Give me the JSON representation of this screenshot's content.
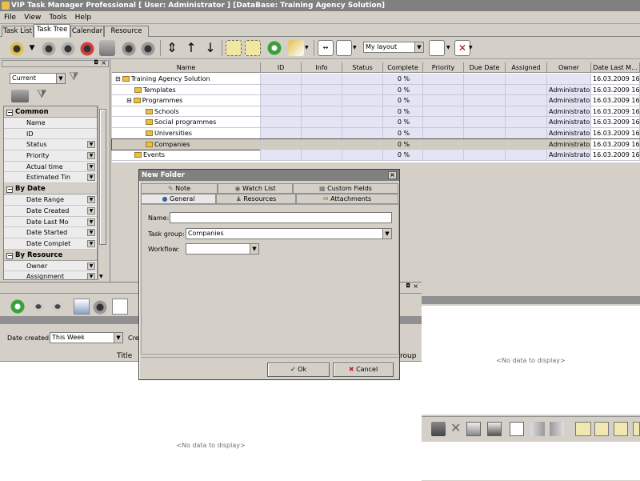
{
  "window": {
    "title": "VIP Task Manager Professional [ User: Administrator ] [DataBase: Training Agency Solution]"
  },
  "menu": [
    "File",
    "View",
    "Tools",
    "Help"
  ],
  "tabs": [
    "Task List",
    "Task Tree",
    "Calendar",
    "Resource List"
  ],
  "toolbar": {
    "layout_value": "My layout"
  },
  "filter": {
    "view_value": "Current",
    "sections": [
      {
        "title": "Common",
        "rows": [
          "Name",
          "ID",
          "Status",
          "Priority",
          "Actual time",
          "Estimated Tin"
        ]
      },
      {
        "title": "By Date",
        "rows": [
          "Date Range",
          "Date Created",
          "Date Last Mo",
          "Date Started",
          "Date Complet"
        ]
      },
      {
        "title": "By Resource",
        "rows": [
          "Owner",
          "Assignment"
        ]
      }
    ]
  },
  "grid": {
    "columns": [
      "Name",
      "ID",
      "Info",
      "Status",
      "Complete",
      "Priority",
      "Due Date",
      "Assigned",
      "Owner",
      "Date Last M..."
    ],
    "rows": [
      {
        "name": "Training Agency Solution",
        "complete": "0 %",
        "owner": "",
        "date": "16.03.2009 16:",
        "level": 0,
        "toggle": "−"
      },
      {
        "name": "Templates",
        "complete": "0 %",
        "owner": "Administrator",
        "date": "16.03.2009 16:",
        "level": 1,
        "toggle": ""
      },
      {
        "name": "Programmes",
        "complete": "0 %",
        "owner": "Administrator",
        "date": "16.03.2009 16:",
        "level": 1,
        "toggle": "−"
      },
      {
        "name": "Schools",
        "complete": "0 %",
        "owner": "Administrator",
        "date": "16.03.2009 16:",
        "level": 2,
        "toggle": ""
      },
      {
        "name": "Social programmes",
        "complete": "0 %",
        "owner": "Administrator",
        "date": "16.03.2009 16:",
        "level": 2,
        "toggle": ""
      },
      {
        "name": "Universities",
        "complete": "0 %",
        "owner": "Administrator",
        "date": "16.03.2009 16:",
        "level": 2,
        "toggle": ""
      },
      {
        "name": "Companies",
        "complete": "0 %",
        "owner": "Administrator",
        "date": "16.03.2009 16:",
        "level": 2,
        "toggle": "",
        "selected": true
      },
      {
        "name": "Events",
        "complete": "0 %",
        "owner": "Administrator",
        "date": "16.03.2009 16:",
        "level": 1,
        "toggle": ""
      }
    ]
  },
  "bottom": {
    "date_created_label": "Date created:",
    "date_created_value": "This Week",
    "cut_label": "Cre",
    "title_col": "Title",
    "group_col": "roup",
    "no_data": "<No data to display>"
  },
  "right": {
    "no_data": "<No data to display>"
  },
  "dialog": {
    "title": "New Folder",
    "tabs_top": [
      "Note",
      "Watch List",
      "Custom Fields"
    ],
    "tabs_bottom": [
      "General",
      "Resources",
      "Attachments"
    ],
    "name_label": "Name:",
    "name_value": "",
    "taskgroup_label": "Task group:",
    "taskgroup_value": "Companies",
    "workflow_label": "Workflow:",
    "workflow_value": "",
    "ok_label": "Ok",
    "cancel_label": "Cancel"
  }
}
